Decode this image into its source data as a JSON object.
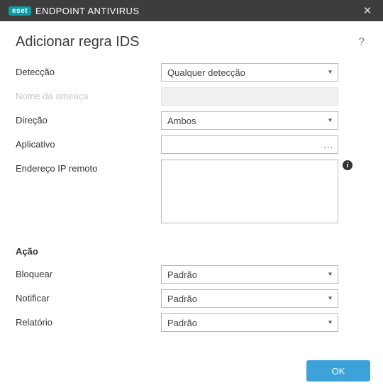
{
  "titlebar": {
    "brand_badge": "eset",
    "app_name": "ENDPOINT ANTIVIRUS"
  },
  "header": {
    "title": "Adicionar regra IDS"
  },
  "form": {
    "deteccao": {
      "label": "Detecção",
      "value": "Qualquer detecção"
    },
    "nome_ameaca": {
      "label": "Nome da ameaça",
      "value": ""
    },
    "direcao": {
      "label": "Direção",
      "value": "Ambos"
    },
    "aplicativo": {
      "label": "Aplicativo",
      "value": ""
    },
    "endereco_ip": {
      "label": "Endereço IP remoto",
      "value": ""
    }
  },
  "acao": {
    "heading": "Ação",
    "bloquear": {
      "label": "Bloquear",
      "value": "Padrão"
    },
    "notificar": {
      "label": "Notificar",
      "value": "Padrão"
    },
    "relatorio": {
      "label": "Relatório",
      "value": "Padrão"
    }
  },
  "footer": {
    "ok_label": "OK"
  }
}
